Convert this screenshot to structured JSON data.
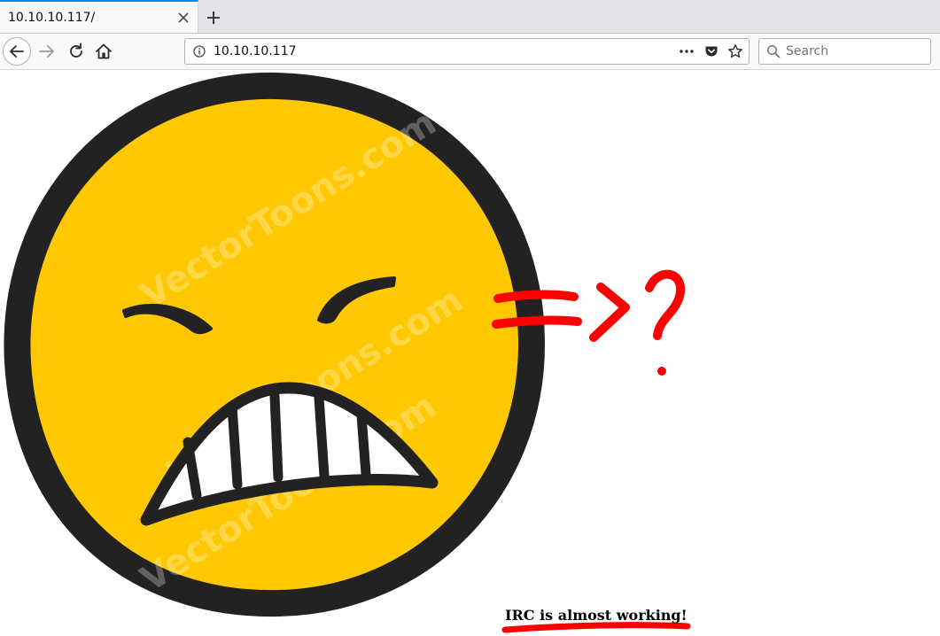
{
  "tab": {
    "title": "10.10.10.117/"
  },
  "address_bar": {
    "url": "10.10.10.117"
  },
  "search": {
    "placeholder": "Search"
  },
  "page": {
    "annotation": "=>?",
    "caption": "IRC is almost working!",
    "watermark": "VectorToons.com",
    "colors": {
      "face": "#ffc800",
      "outline": "#222222",
      "marker": "#ff0000"
    }
  },
  "icons": {
    "back": "back-arrow-icon",
    "forward": "forward-arrow-icon",
    "reload": "reload-icon",
    "home": "home-icon",
    "site_info": "info-icon",
    "page_actions": "more-icon",
    "pocket": "pocket-icon",
    "bookmark": "star-icon",
    "search": "magnifier-icon",
    "close_tab": "close-icon",
    "new_tab": "plus-icon"
  }
}
